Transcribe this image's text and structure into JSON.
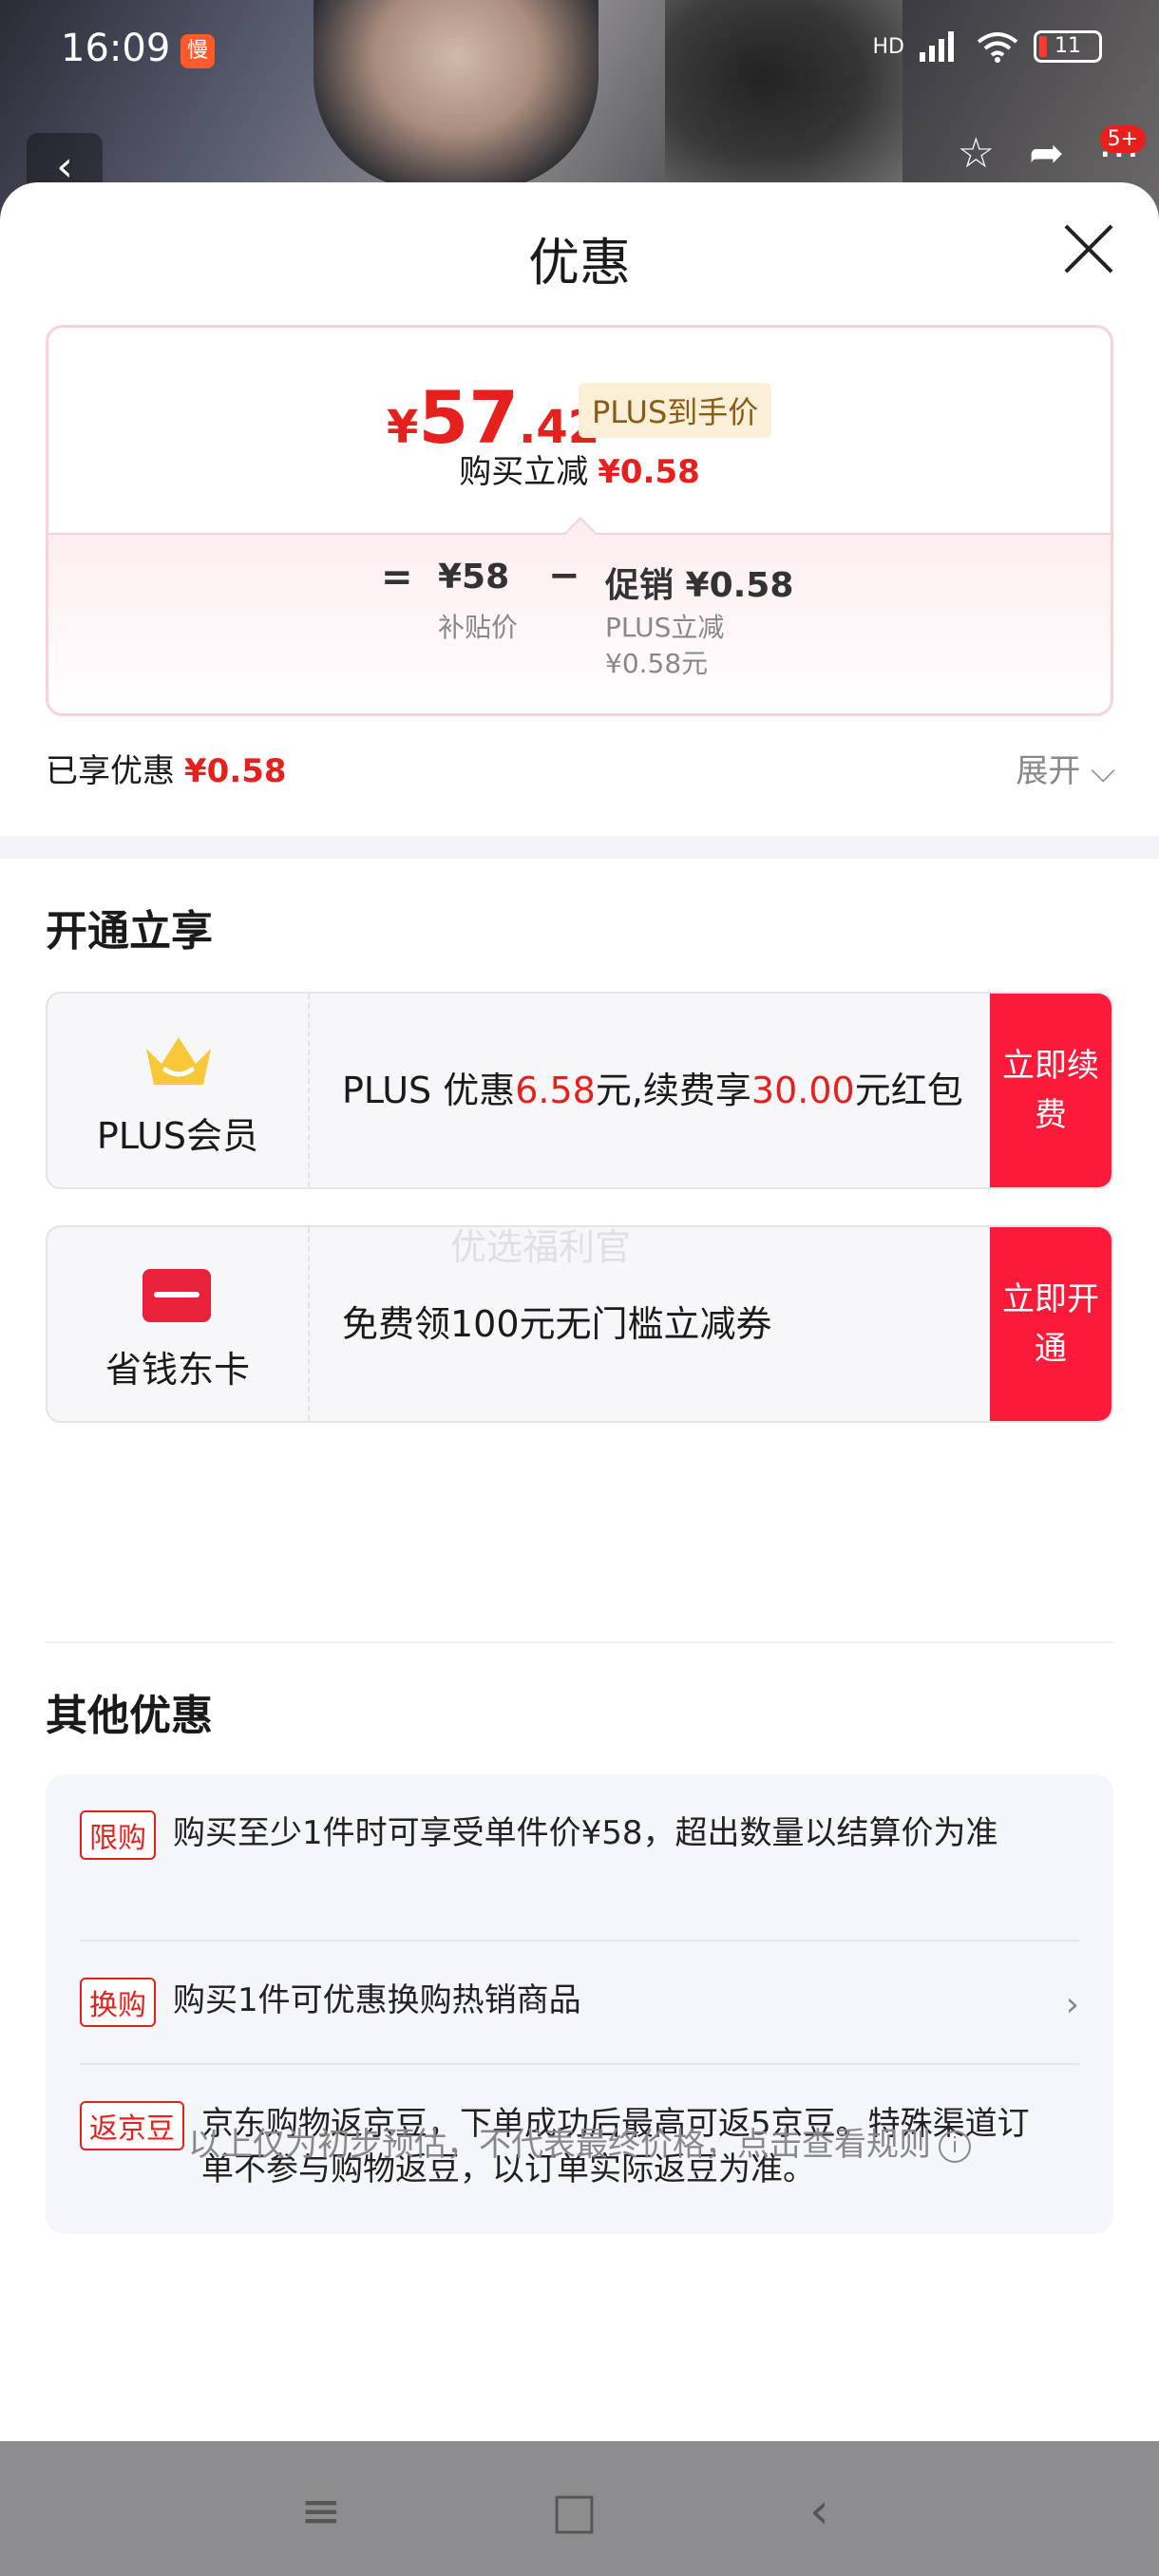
{
  "status_bar": {
    "time": "16:09",
    "app_badge": "慢",
    "signal": "HD",
    "battery": "11"
  },
  "top_nav": {
    "notification_count": "5+"
  },
  "sheet": {
    "title": "优惠"
  },
  "price_card": {
    "currency": "¥",
    "price_int": "57",
    "price_dec": ".42",
    "plus_tag": "PLUS到手价",
    "reduce_label": "购买立减",
    "reduce_value": "¥0.58",
    "eq": "=",
    "subsidy_value": "¥58",
    "subsidy_label": "补贴价",
    "minus": "−",
    "promo_value": "促销 ¥0.58",
    "promo_sub1": "PLUS立减",
    "promo_sub2": "¥0.58元"
  },
  "enjoyed": {
    "label": "已享优惠",
    "value": "¥0.58",
    "expand": "展开 ⌵"
  },
  "open_section": {
    "title": "开通立享",
    "offers": [
      {
        "name": "PLUS会员",
        "text_a": "PLUS 优惠",
        "num_a": "6.58",
        "text_b": "元,续费享",
        "num_b": "30.00",
        "text_c": "元红包",
        "button": "立即续费",
        "icon": "crown-icon"
      },
      {
        "name": "省钱东卡",
        "text": "免费领100元无门槛立减券",
        "button": "立即开通",
        "icon": "card-icon"
      }
    ]
  },
  "watermark": "优选福利官",
  "other_section": {
    "title": "其他优惠",
    "items": [
      {
        "tag": "限购",
        "text": "购买至少1件时可享受单件价¥58，超出数量以结算价为准"
      },
      {
        "tag": "换购",
        "text": "购买1件可优惠换购热销商品",
        "chevron": "›"
      },
      {
        "tag": "返京豆",
        "text": "京东购物返京豆，下单成功后最高可返5京豆。特殊渠道订单不参与购物返豆，以订单实际返豆为准。"
      }
    ]
  },
  "footer": {
    "note": "以上仅为初步预估，不代表最终价格，点击查看规则",
    "info": "i"
  },
  "system_nav": {
    "menu": "≡",
    "home": "□",
    "back": "‹"
  },
  "colors": {
    "accent_red": "#e6211d",
    "button_red": "#fb1a3a",
    "plus_gold": "#8a5a17"
  }
}
